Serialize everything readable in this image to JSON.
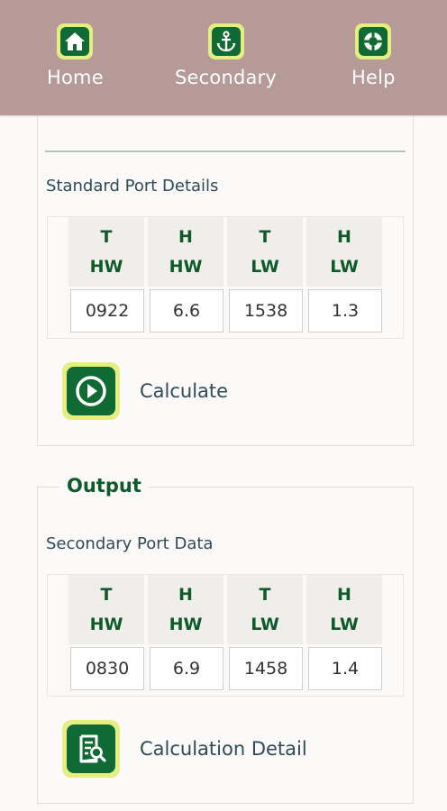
{
  "nav": {
    "home_label": "Home",
    "secondary_label": "Secondary",
    "help_label": "Help"
  },
  "input": {
    "section_label": "Standard Port Details",
    "headers": [
      {
        "line1": "T",
        "line2": "HW"
      },
      {
        "line1": "H",
        "line2": "HW"
      },
      {
        "line1": "T",
        "line2": "LW"
      },
      {
        "line1": "H",
        "line2": "LW"
      }
    ],
    "values": [
      "0922",
      "6.6",
      "1538",
      "1.3"
    ],
    "calculate_label": "Calculate"
  },
  "output": {
    "legend": "Output",
    "section_label": "Secondary Port Data",
    "headers": [
      {
        "line1": "T",
        "line2": "HW"
      },
      {
        "line1": "H",
        "line2": "HW"
      },
      {
        "line1": "T",
        "line2": "LW"
      },
      {
        "line1": "H",
        "line2": "LW"
      }
    ],
    "values": [
      "0830",
      "6.9",
      "1458",
      "1.4"
    ],
    "detail_label": "Calculation Detail"
  },
  "colors": {
    "topbar": "#b59a97",
    "icon_bg": "#e6ee82",
    "icon_fg": "#0f6a33",
    "header_text": "#0f5a2a",
    "label_text": "#2f4a58"
  },
  "icons": {
    "home": "home-icon",
    "secondary": "anchor-icon",
    "help": "lifebuoy-icon",
    "calculate": "play-circle-icon",
    "detail": "document-search-icon"
  }
}
